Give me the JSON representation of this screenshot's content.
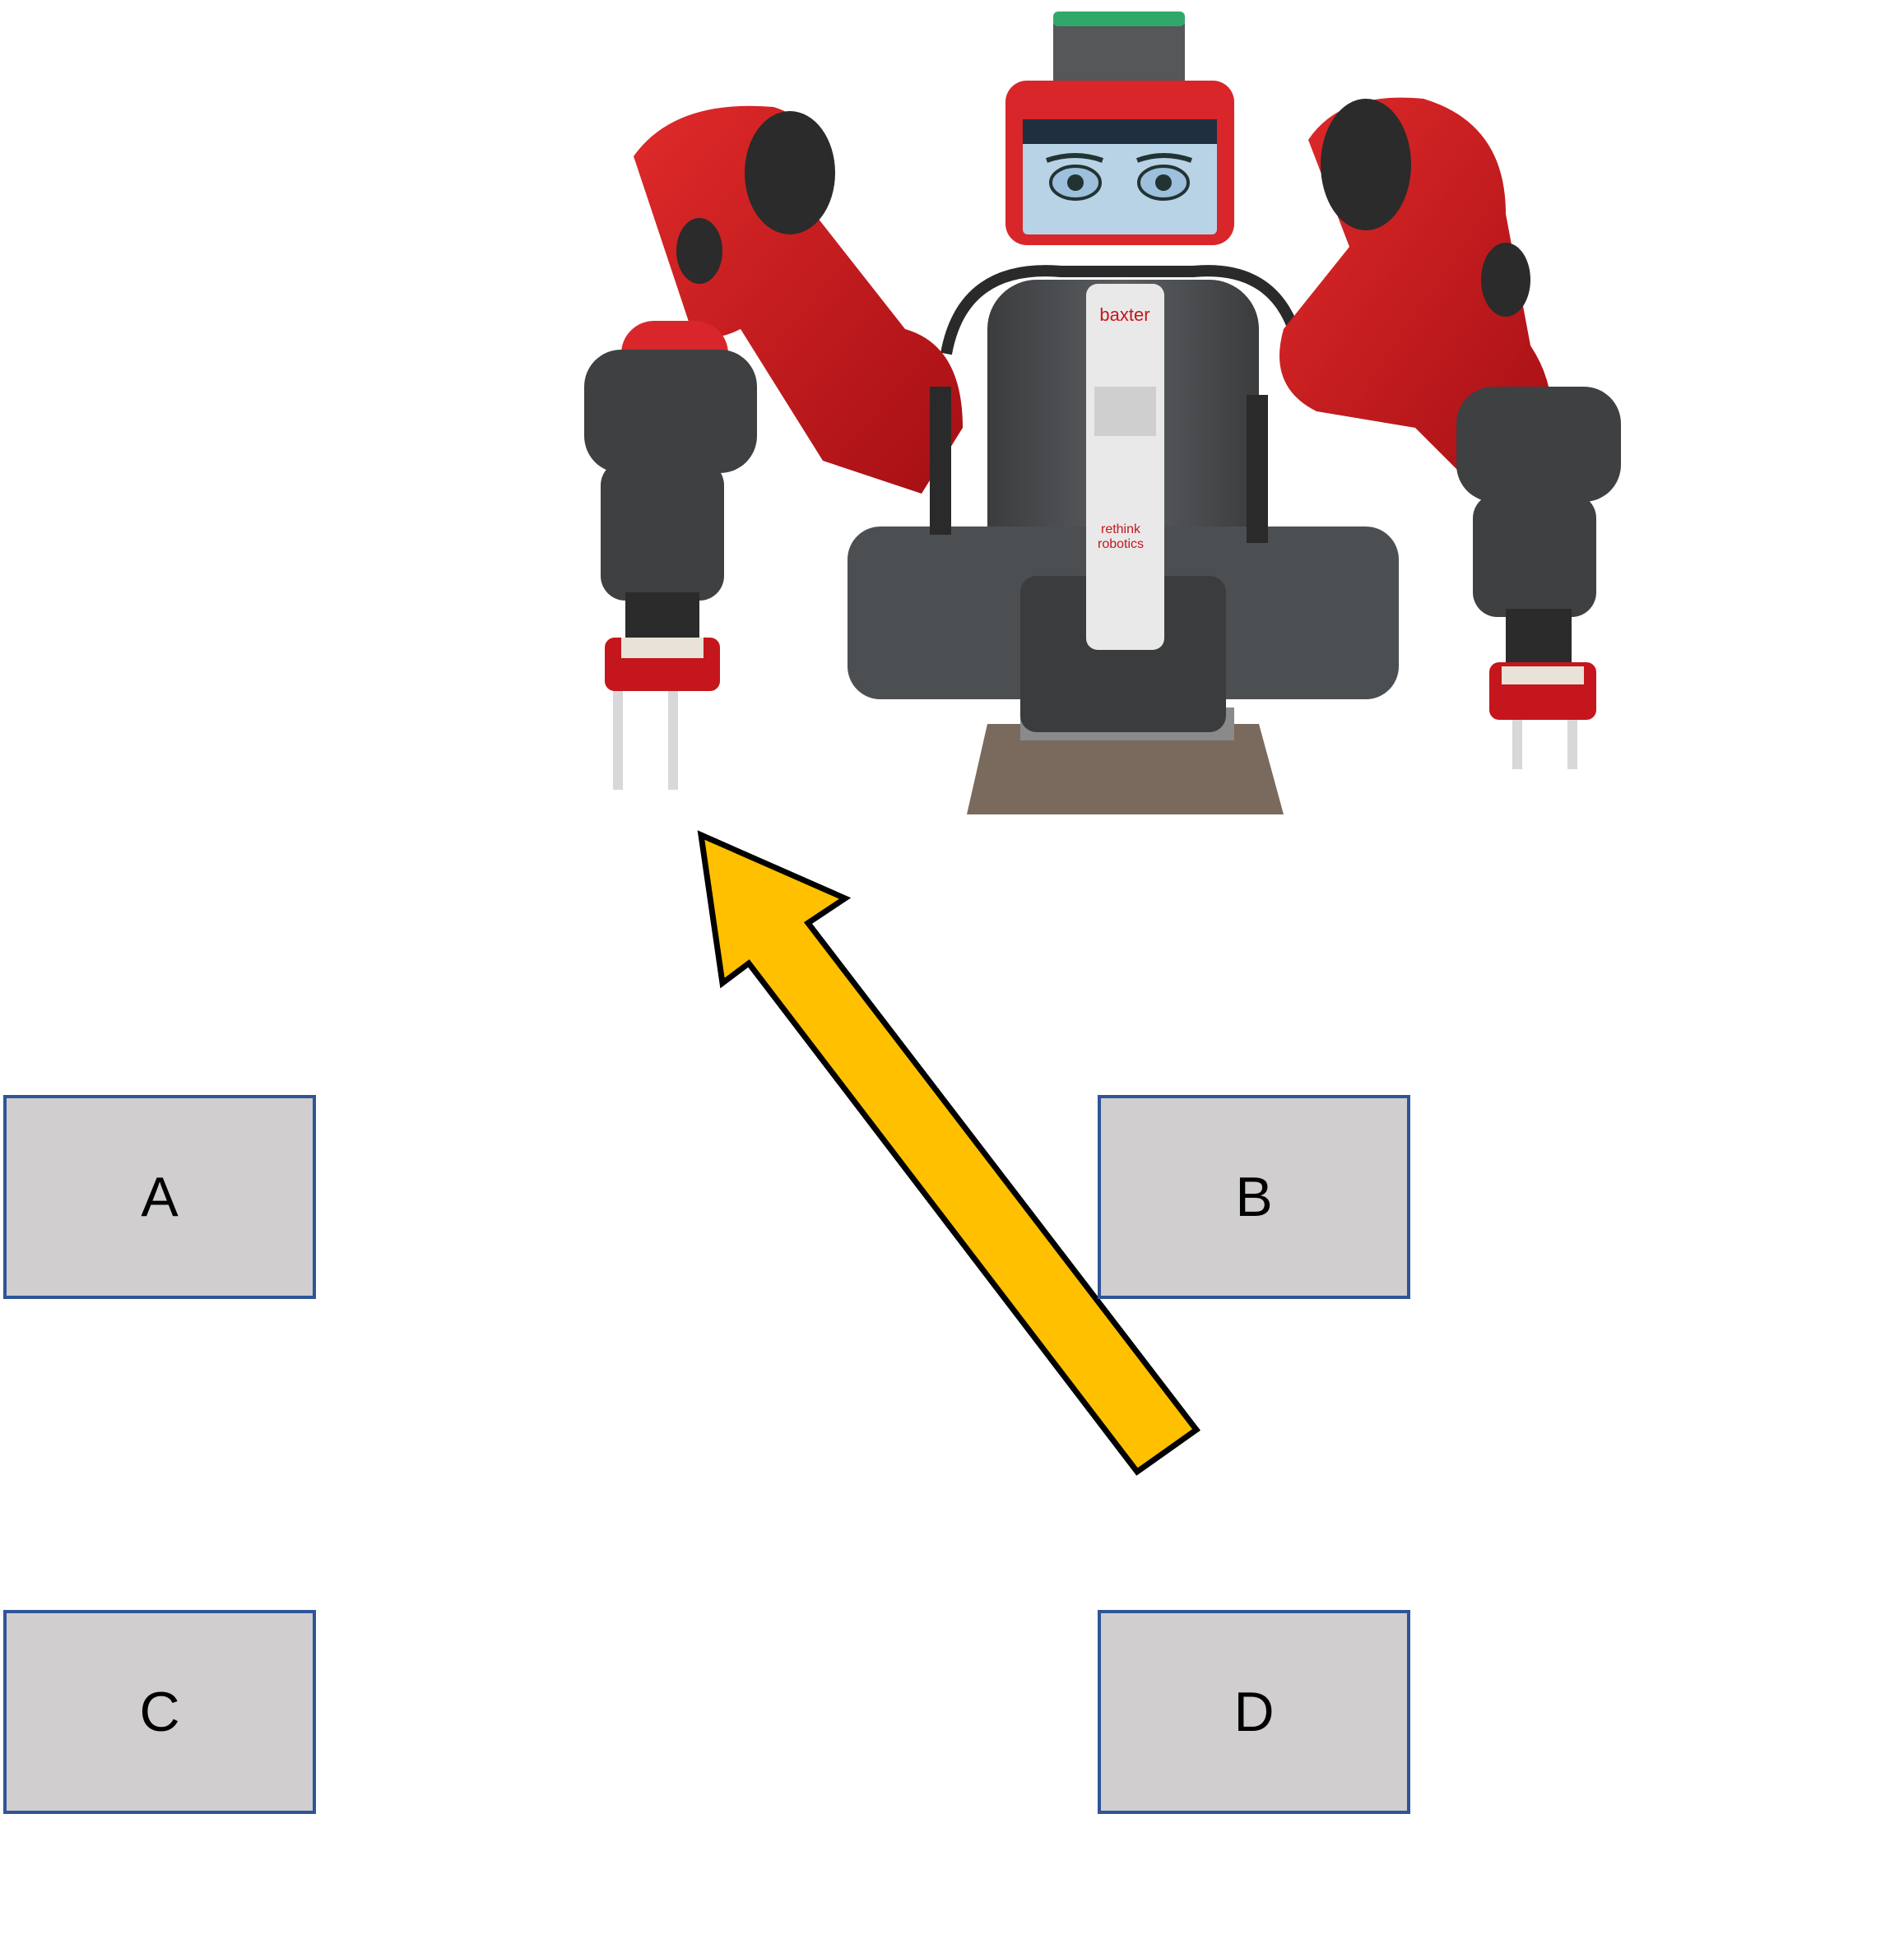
{
  "robot": {
    "icon": "baxter-robot-illustration",
    "brand_mark": "baxter",
    "maker_mark": "rethink robotics"
  },
  "colors": {
    "robot_red": "#c4161c",
    "robot_gray": "#4a4c4e",
    "arrow_fill": "#ffc000",
    "arrow_stroke": "#000000",
    "box_fill": "#d0cece",
    "box_border": "#2f5597"
  },
  "boxes": {
    "a": {
      "label": "A"
    },
    "b": {
      "label": "B"
    },
    "c": {
      "label": "C"
    },
    "d": {
      "label": "D"
    }
  },
  "arrow": {
    "icon": "arrow-up-left-icon"
  }
}
